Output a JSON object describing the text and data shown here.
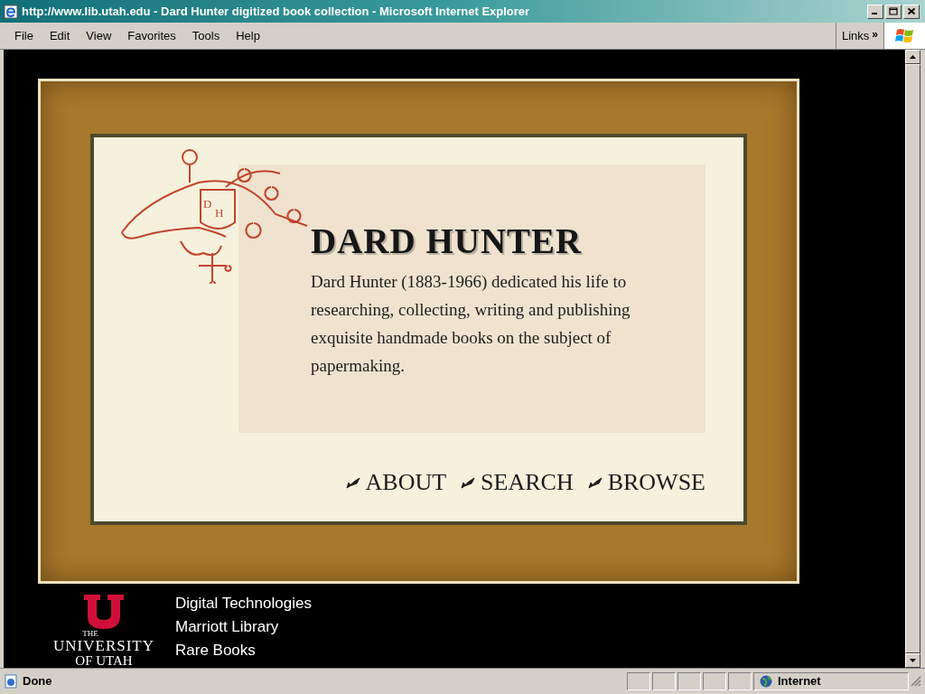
{
  "window": {
    "title": "http://www.lib.utah.edu - Dard Hunter digitized book collection - Microsoft Internet Explorer"
  },
  "menu": [
    "File",
    "Edit",
    "View",
    "Favorites",
    "Tools",
    "Help"
  ],
  "links_button": {
    "label": "Links",
    "chevron": "»"
  },
  "page": {
    "monogram_letters": [
      "D",
      "H"
    ],
    "heading": "DARD HUNTER",
    "description": "Dard Hunter (1883-1966) dedicated his life to researching, collecting, writing and publishing exquisite handmade books on the subject of papermaking.",
    "nav": [
      "ABOUT",
      "SEARCH",
      "BROWSE"
    ],
    "university_logo": [
      "THE",
      "UNIVERSITY",
      "OF UTAH"
    ],
    "footer_links": [
      "Digital Technologies",
      "Marriott Library",
      "Rare Books"
    ]
  },
  "status_bar": {
    "text": "Done",
    "zone": "Internet"
  }
}
